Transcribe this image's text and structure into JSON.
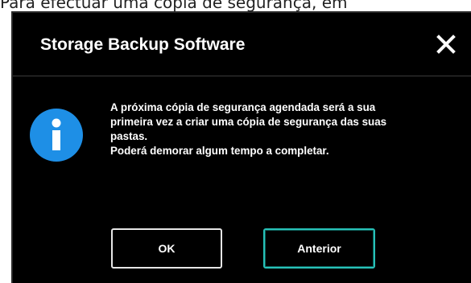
{
  "background": {
    "text": "Para efectuar uma cópia de segurança, em"
  },
  "dialog": {
    "title": "Storage Backup Software",
    "close_icon": "close-icon",
    "info_icon": "info-icon",
    "message_lines": [
      "A próxima cópia de segurança agendada será a sua",
      "primeira vez a criar uma cópia de segurança das suas",
      "pastas.",
      "Poderá demorar algum tempo a completar."
    ],
    "buttons": {
      "ok_label": "OK",
      "back_label": "Anterior"
    }
  },
  "colors": {
    "dialog_background": "#000000",
    "text": "#ffffff",
    "info_icon": "#1e8fe6",
    "focus_border": "#27c1b8"
  }
}
